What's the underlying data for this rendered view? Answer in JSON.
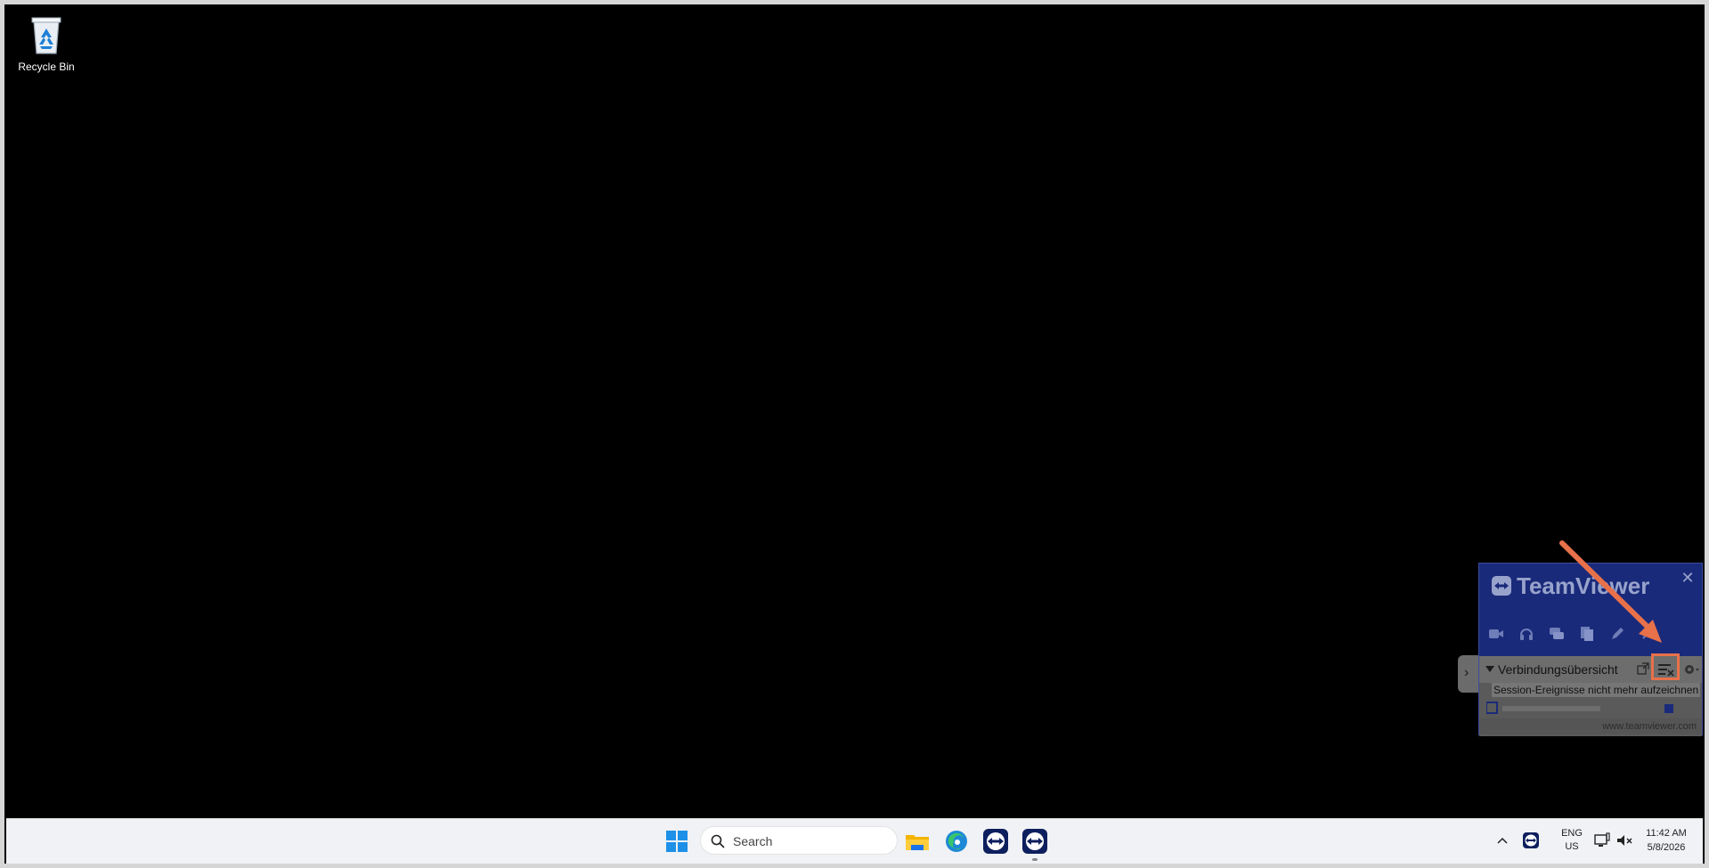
{
  "desktop": {
    "icons": [
      {
        "label": "Recycle Bin",
        "icon": "recycle-bin-icon"
      }
    ]
  },
  "teamviewer": {
    "title": "TeamViewer",
    "close_icon": "close-icon",
    "toolbar": [
      {
        "icon": "video-icon"
      },
      {
        "icon": "headset-icon"
      },
      {
        "icon": "chat-icon"
      },
      {
        "icon": "file-transfer-icon"
      },
      {
        "icon": "pen-icon"
      },
      {
        "icon": "close-x-icon"
      }
    ],
    "section": {
      "title": "Verbindungsübersicht",
      "popout_icon": "popout-icon",
      "record_icon": "record-events-icon",
      "gear_icon": "gear-icon",
      "tooltip": "Session-Ereignisse nicht mehr aufzeichnen"
    },
    "footer": "www.teamviewer.com",
    "side_tab_glyph": "›"
  },
  "annotation": {
    "color": "#e8714a"
  },
  "taskbar": {
    "search_placeholder": "Search",
    "apps": [
      {
        "name": "file-explorer",
        "icon": "folder-icon"
      },
      {
        "name": "edge",
        "icon": "edge-icon"
      },
      {
        "name": "teamviewer-1",
        "icon": "teamviewer-icon"
      },
      {
        "name": "teamviewer-2",
        "icon": "teamviewer-icon",
        "active": true
      }
    ],
    "tray": {
      "lang_line1": "ENG",
      "lang_line2": "US",
      "time": "11:42 AM",
      "date": "5/8/2026"
    }
  },
  "colors": {
    "taskbar_bg": "#f0f2f5",
    "teamviewer_blue": "#1a2a7a",
    "windows_blue": "#1e90e8"
  }
}
